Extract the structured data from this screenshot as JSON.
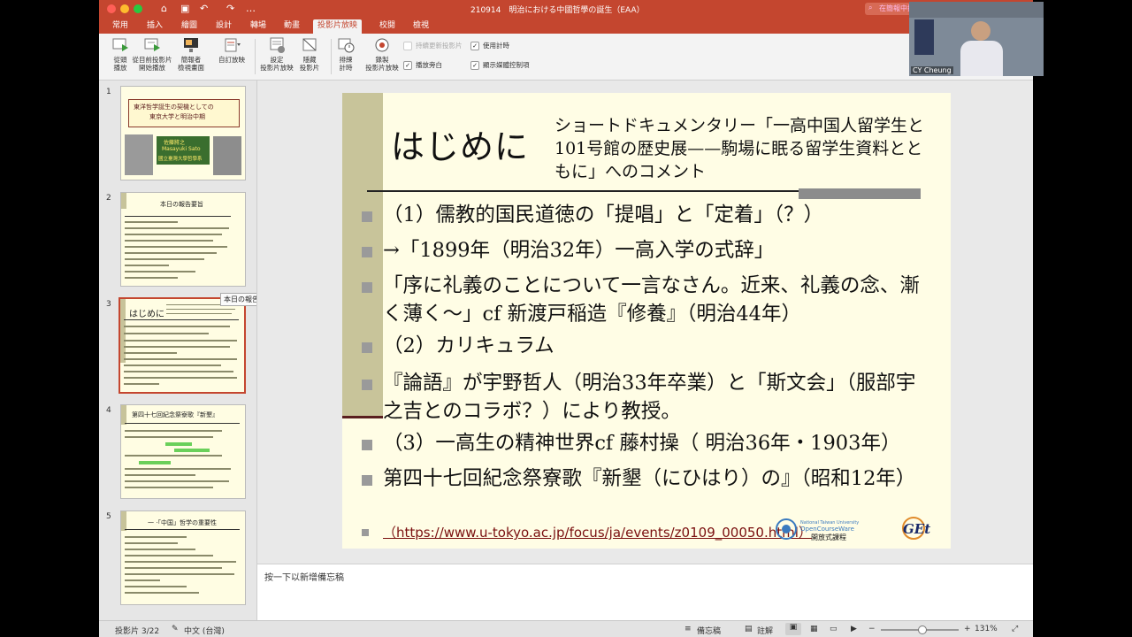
{
  "window": {
    "title": "210914　明治における中國哲學の誕生（EAA）",
    "search_placeholder": "在簡報中搜尋"
  },
  "tabs": [
    {
      "label": "常用",
      "active": false
    },
    {
      "label": "插入",
      "active": false
    },
    {
      "label": "繪圖",
      "active": false
    },
    {
      "label": "設計",
      "active": false
    },
    {
      "label": "轉場",
      "active": false
    },
    {
      "label": "動畫",
      "active": false
    },
    {
      "label": "投影片放映",
      "active": true
    },
    {
      "label": "校閱",
      "active": false
    },
    {
      "label": "檢視",
      "active": false
    }
  ],
  "ribbon": {
    "from_start_l1": "從頭",
    "from_start_l2": "播放",
    "from_current_l1": "從目前投影片",
    "from_current_l2": "開始播放",
    "presenter_l1": "簡報者",
    "presenter_l2": "檢視畫面",
    "custom_l1": "自訂放映",
    "setup_l1": "設定",
    "setup_l2": "投影片放映",
    "hide_l1": "隱藏",
    "hide_l2": "投影片",
    "rehearse_l1": "排練",
    "rehearse_l2": "計時",
    "record_l1": "錄製",
    "record_l2": "投影片放映",
    "chk_keep_updated": "持續更新投影片",
    "chk_use_timings": "使用計時",
    "chk_narration": "播放旁白",
    "chk_media_controls": "顯示媒體控制項"
  },
  "thumbnails": {
    "n1": "1",
    "n2": "2",
    "n3": "3",
    "n4": "4",
    "n5": "5",
    "t1_title1": "東洋哲学誕生の契機としての",
    "t1_title2": "東京大学と明治中期",
    "t1_author": "佐藤將之",
    "t1_author_en": "Masayuki Sato",
    "t1_affil": "國立臺灣大學哲學系",
    "t2_title": "本日の報告要旨",
    "t3_title": "はじめに",
    "t4_title": "第四十七回紀念祭寮歌『新墾』",
    "t5_title": "一 ·「中国」哲学の重要性",
    "tooltip": "本日の報告要旨"
  },
  "slide": {
    "heading": "はじめに",
    "subheading": "ショートドキュメンタリー「一高中国人留学生と101号館の歴史展——駒場に眠る留学生資料とともに」へのコメント",
    "b1": "（1）儒教的国民道徳の「提唱」と「定着」（？）",
    "b2": "→「1899年（明治32年）一高入学の式辞」",
    "b3": "「序に礼義のことについて一言なさん。近来、礼義の念、漸く薄く～」cf 新渡戸稲造『修養』（明治44年）",
    "b4": "（2）カリキュラム",
    "b5": "『論語』が宇野哲人（明治33年卒業）と「斯文会」（服部宇之吉とのコラボ？）により教授。",
    "b6": "（3）一高生の精神世界cf 藤村操（ 明治36年・1903年）",
    "b7": "第四十七回紀念祭寮歌『新墾（にひはり）の』（昭和12年）",
    "url": "（https://www.u-tokyo.ac.jp/focus/ja/events/z0109_00050.html）",
    "logo_ocw_line1": "National Taiwan University",
    "logo_ocw_line2": "OpenCourseWare",
    "logo_ocw_line3": "開放式課程",
    "logo_get": "GEt"
  },
  "notes": {
    "placeholder": "按一下以新增備忘稿"
  },
  "status": {
    "slide_pos": "投影片 3/22",
    "language": "中文 (台灣)",
    "notes_btn": "備忘稿",
    "comments_btn": "註解",
    "zoom": "131%"
  },
  "video": {
    "name": "CY Cheung"
  },
  "colors": {
    "accent": "#c4462f",
    "slide_bg": "#fffde5",
    "slide_bar": "#c8c49a",
    "link": "#7a0f0f"
  }
}
